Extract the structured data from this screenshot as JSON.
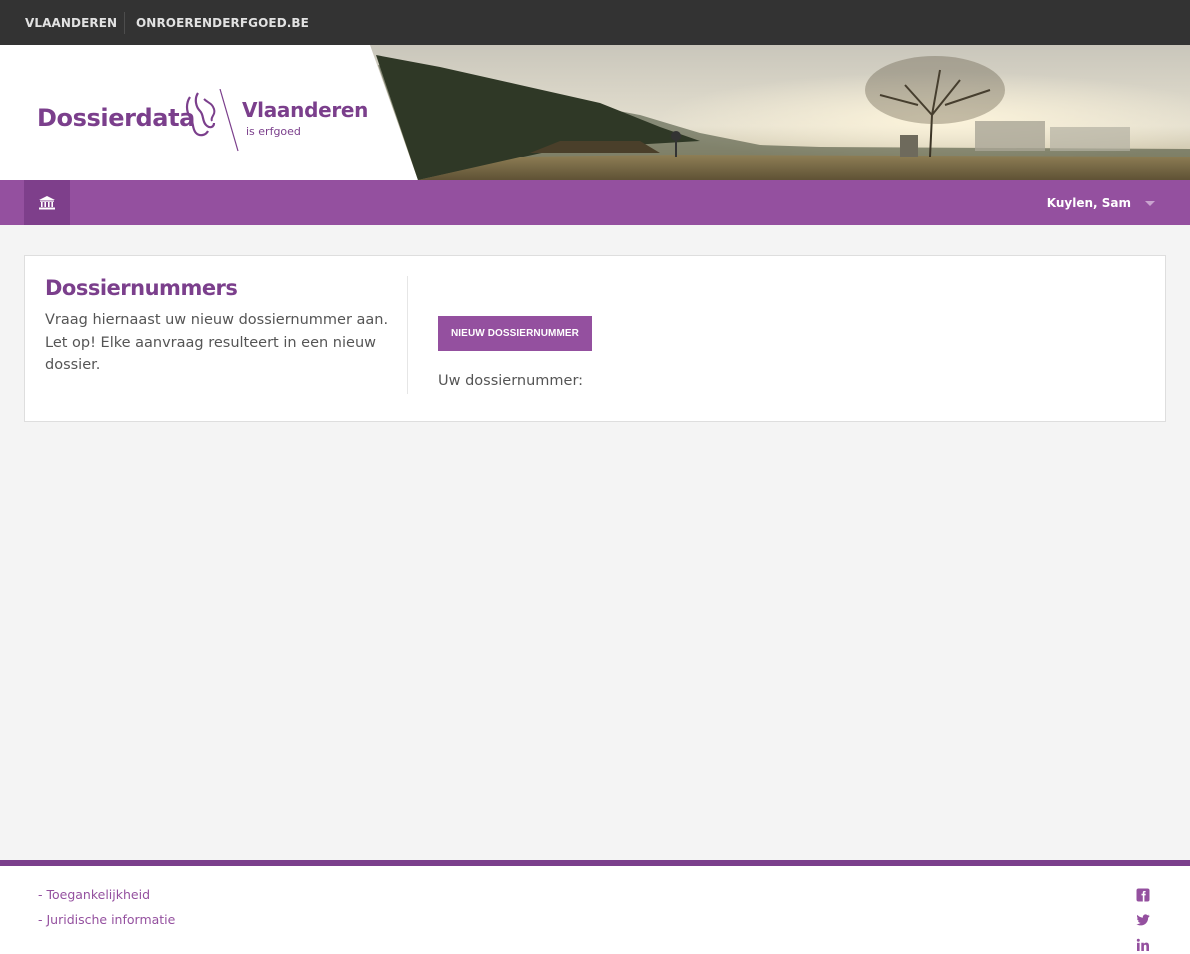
{
  "topbar": {
    "links": [
      {
        "label": "VLAANDEREN"
      },
      {
        "label": "ONROERENDERFGOED.BE"
      }
    ]
  },
  "brand": {
    "title": "Dossierdata",
    "logo_name": "Vlaanderen",
    "logo_sub": "is erfgoed"
  },
  "nav": {
    "home_icon": "museum-icon",
    "user": "Kuylen, Sam"
  },
  "card": {
    "title": "Dossiernummers",
    "description": "Vraag hiernaast uw nieuw dossiernummer aan. Let op! Elke aanvraag resulteert in een nieuw dossier.",
    "button_label": "NIEUW DOSSIERNUMMER",
    "result_label": "Uw dossiernummer:"
  },
  "footer": {
    "links": [
      {
        "label": "- Toegankelijkheid"
      },
      {
        "label": "- Juridische informatie"
      }
    ],
    "social": [
      "facebook-icon",
      "twitter-icon",
      "linkedin-icon"
    ]
  },
  "colors": {
    "brand_purple": "#94509f",
    "brand_dark_purple": "#7b3f8c",
    "topbar": "#333333"
  }
}
